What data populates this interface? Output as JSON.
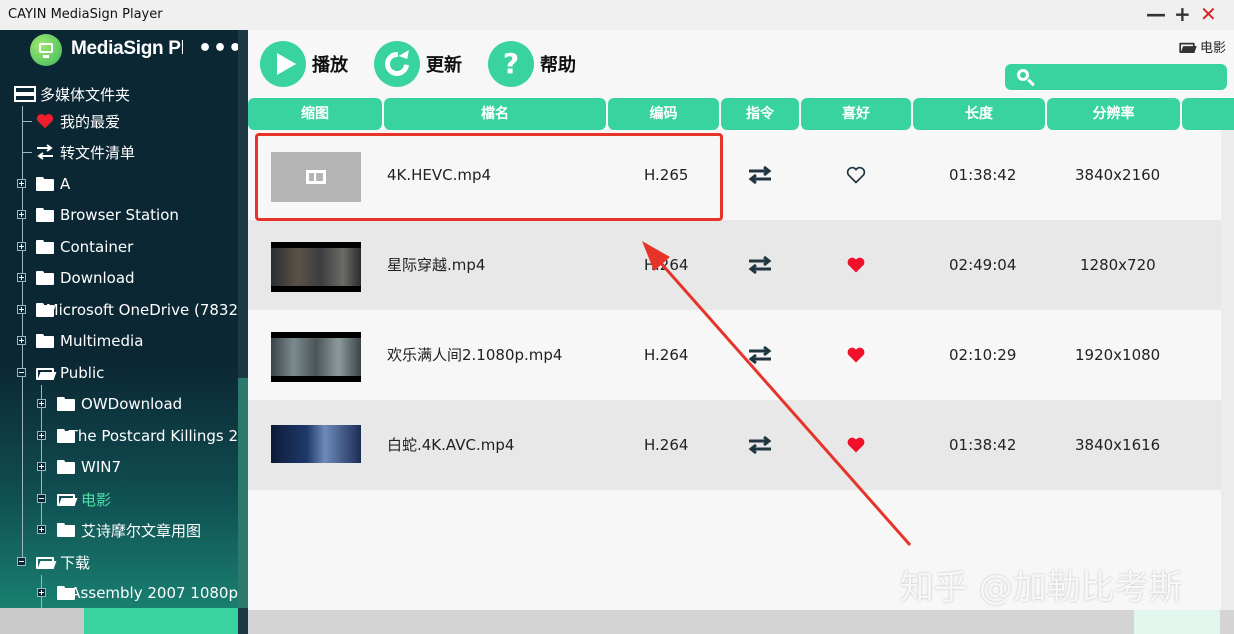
{
  "window": {
    "title": "CAYIN MediaSign Player",
    "controls": [
      "—",
      "+",
      "✕"
    ]
  },
  "sidebar": {
    "brand": "MediaSign Player",
    "more": "•••",
    "items": [
      {
        "label": "多媒体文件夹",
        "icon": "drive-icon"
      },
      {
        "label": "我的最爱",
        "icon": "heart-icon"
      },
      {
        "label": "转文件清单",
        "icon": "swap-icon"
      },
      {
        "label": "A",
        "icon": "folder-icon"
      },
      {
        "label": "Browser Station",
        "icon": "folder-icon"
      },
      {
        "label": "Container",
        "icon": "folder-icon"
      },
      {
        "label": "Download",
        "icon": "folder-icon"
      },
      {
        "label": "Microsoft OneDrive (7832",
        "icon": "folder-icon"
      },
      {
        "label": "Multimedia",
        "icon": "folder-icon"
      },
      {
        "label": "Public",
        "icon": "folder-open-icon"
      },
      {
        "label": "OWDownload",
        "icon": "folder-icon"
      },
      {
        "label": "The Postcard Killings 2",
        "icon": "folder-icon"
      },
      {
        "label": "WIN7",
        "icon": "folder-icon"
      },
      {
        "label": "电影",
        "icon": "folder-open-icon"
      },
      {
        "label": "艾诗摩尔文章用图",
        "icon": "folder-icon"
      },
      {
        "label": "下载",
        "icon": "folder-open-icon"
      },
      {
        "label": "Assembly 2007 1080p",
        "icon": "folder-icon"
      }
    ]
  },
  "toolbar": {
    "play": "播放",
    "refresh": "更新",
    "help": "帮助",
    "help_glyph": "?"
  },
  "breadcrumb": "电影",
  "search": {
    "placeholder": ""
  },
  "table": {
    "headers": [
      "缩图",
      "檔名",
      "编码",
      "指令",
      "喜好",
      "长度",
      "分辨率"
    ],
    "rows": [
      {
        "name": "4K.HEVC.mp4",
        "codec": "H.265",
        "favorite": false,
        "length": "01:38:42",
        "resolution": "3840x2160"
      },
      {
        "name": "星际穿越.mp4",
        "codec": "H.264",
        "favorite": true,
        "length": "02:49:04",
        "resolution": "1280x720"
      },
      {
        "name": "欢乐满人间2.1080p.mp4",
        "codec": "H.264",
        "favorite": true,
        "length": "02:10:29",
        "resolution": "1920x1080"
      },
      {
        "name": "白蛇.4K.AVC.mp4",
        "codec": "H.264",
        "favorite": true,
        "length": "01:38:42",
        "resolution": "3840x1616"
      }
    ]
  },
  "watermark": "知乎 @加勒比考斯",
  "colors": {
    "accent": "#38d39f",
    "sidebar_bg": "#0c2734",
    "highlight": "#e6342a",
    "active_item": "#4fe0a8"
  }
}
